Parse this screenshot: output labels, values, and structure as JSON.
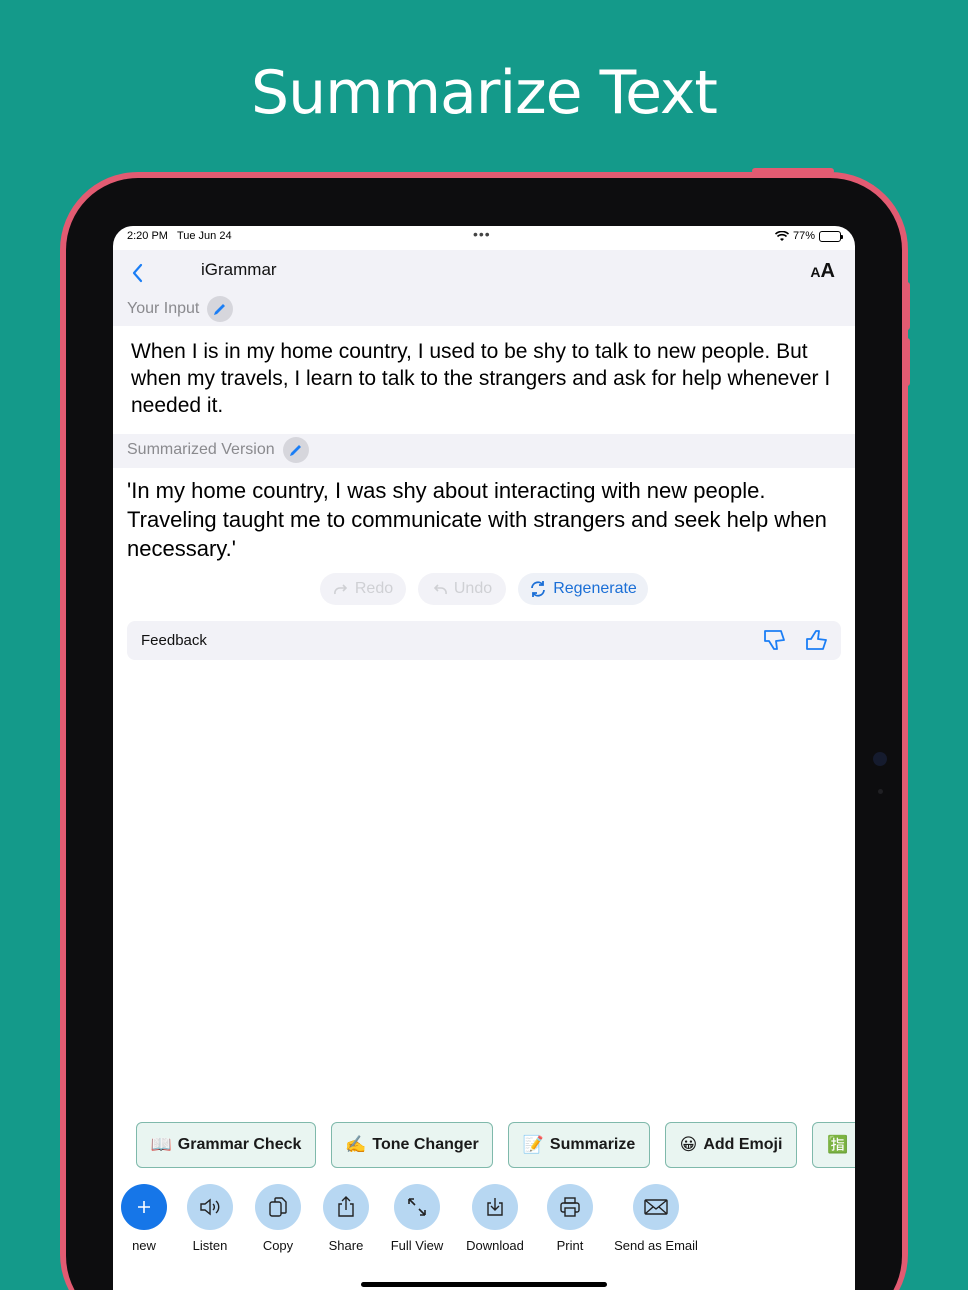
{
  "headline": "Summarize Text",
  "status": {
    "time": "2:20 PM",
    "date": "Tue Jun 24",
    "battery": "77%",
    "battery_level": 0.77
  },
  "nav": {
    "title": "iGrammar",
    "aa_small": "A",
    "aa_large": "A"
  },
  "input_section": {
    "label": "Your Input",
    "text": "When I is in my home country, I used to be shy to talk to new people. But when my travels, I learn to talk to the strangers and ask for help whenever I needed it."
  },
  "summary_section": {
    "label": "Summarized Version",
    "text": "'In my home country, I was shy about interacting with new people. Traveling taught me to communicate with strangers and seek help when necessary.'"
  },
  "actions": {
    "redo": "Redo",
    "undo": "Undo",
    "regenerate": "Regenerate"
  },
  "feedback": {
    "label": "Feedback"
  },
  "chips": [
    {
      "emoji": "📖",
      "label": "Grammar Check"
    },
    {
      "emoji": "✍️",
      "label": "Tone Changer"
    },
    {
      "emoji": "📝",
      "label": "Summarize"
    },
    {
      "emoji": "😀",
      "label": "Add Emoji"
    },
    {
      "emoji": "🈯",
      "label": ""
    }
  ],
  "toolbar": [
    {
      "icon": "plus-icon",
      "label": "new"
    },
    {
      "icon": "speaker-icon",
      "label": "Listen"
    },
    {
      "icon": "copy-icon",
      "label": "Copy"
    },
    {
      "icon": "share-icon",
      "label": "Share"
    },
    {
      "icon": "expand-icon",
      "label": "Full View"
    },
    {
      "icon": "download-icon",
      "label": "Download"
    },
    {
      "icon": "printer-icon",
      "label": "Print"
    },
    {
      "icon": "envelope-icon",
      "label": "Send as Email"
    }
  ],
  "colors": {
    "background": "#149a8a",
    "accent": "#1b7ef5",
    "device": "#e25b72",
    "chip_border": "#7fb9ab"
  }
}
